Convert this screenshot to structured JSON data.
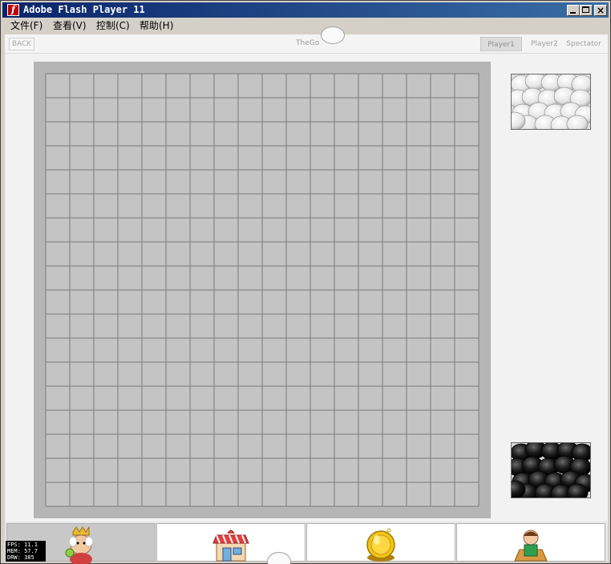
{
  "window": {
    "title": "Adobe Flash Player 11",
    "icon": "flash-logo-icon",
    "icon_glyph": "f",
    "close_glyph": "×"
  },
  "menu": [
    "文件(F)",
    "查看(V)",
    "控制(C)",
    "帮助(H)"
  ],
  "topbar": {
    "back_label": "BACK",
    "game_title": "TheGo",
    "tabs": [
      "Player1",
      "Player2",
      "Spectator"
    ],
    "active_tab": "Player1"
  },
  "board": {
    "grid_columns": 18,
    "grid_rows": 18
  },
  "bowls": {
    "white": "white-stones-icon",
    "black": "black-stones-icon"
  },
  "bottom_buttons": [
    {
      "name": "character-button",
      "icon": "king-character-icon",
      "active": true
    },
    {
      "name": "shop-button",
      "icon": "shop-icon",
      "active": false
    },
    {
      "name": "coins-button",
      "icon": "gold-coin-icon",
      "active": false
    },
    {
      "name": "profile-button",
      "icon": "player-profile-icon",
      "active": false
    }
  ],
  "stats": {
    "fps": "FPS: 11.1",
    "mem": "MEM: 57.7",
    "drw": "DRW: 385"
  },
  "colors": {
    "titlebar_start": "#0a246a",
    "board": "#b5b5b5",
    "stage": "#f2f2f2"
  }
}
